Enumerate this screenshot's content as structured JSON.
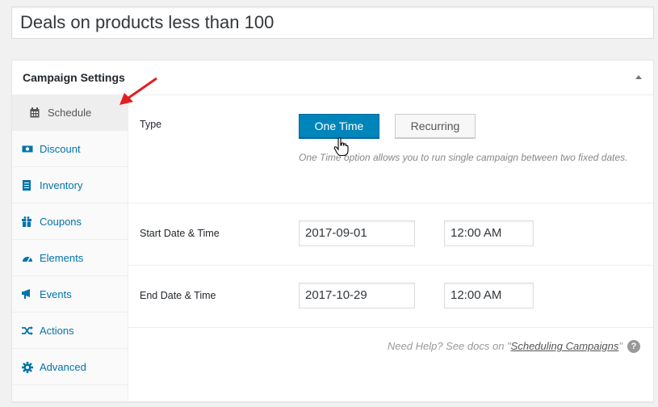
{
  "title": {
    "value": "Deals on products less than 100"
  },
  "panel": {
    "heading": "Campaign Settings",
    "tabs": [
      {
        "label": "Schedule",
        "icon": "calendar-icon",
        "active": true
      },
      {
        "label": "Discount",
        "icon": "money-icon"
      },
      {
        "label": "Inventory",
        "icon": "list-icon"
      },
      {
        "label": "Coupons",
        "icon": "gift-icon"
      },
      {
        "label": "Elements",
        "icon": "dashboard-icon"
      },
      {
        "label": "Events",
        "icon": "megaphone-icon"
      },
      {
        "label": "Actions",
        "icon": "shuffle-icon"
      },
      {
        "label": "Advanced",
        "icon": "gear-icon"
      }
    ]
  },
  "schedule": {
    "type_label": "Type",
    "one_time_label": "One Time",
    "recurring_label": "Recurring",
    "type_description": "One Time option allows you to run single campaign between two fixed dates.",
    "start_label": "Start Date & Time",
    "start_date": "2017-09-01",
    "start_time": "12:00 AM",
    "end_label": "End Date & Time",
    "end_date": "2017-10-29",
    "end_time": "12:00 AM"
  },
  "help": {
    "prefix": "Need Help? See docs on \"",
    "link_text": "Scheduling Campaigns",
    "suffix": "\"",
    "icon_char": "?"
  },
  "colors": {
    "primary_button": "#0085ba",
    "tab_link": "#0073aa",
    "arrow": "#e02020"
  }
}
